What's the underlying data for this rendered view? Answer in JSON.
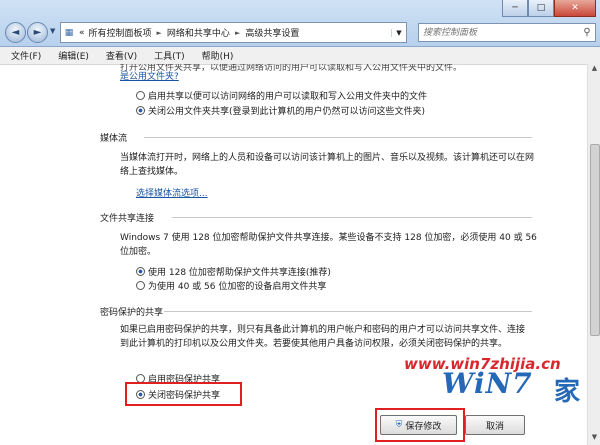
{
  "window": {
    "minimize_glyph": "─",
    "maximize_glyph": "□",
    "close_glyph": "✕"
  },
  "nav": {
    "back_glyph": "◄",
    "forward_glyph": "►",
    "address_icon": "control-panel-icon",
    "address_prefix": "«",
    "breadcrumbs": [
      "所有控制面板项",
      "网络和共享中心",
      "高级共享设置"
    ],
    "refresh_glyph": "↻",
    "search_placeholder": "搜索控制面板"
  },
  "menu": [
    "文件(F)",
    "编辑(E)",
    "查看(V)",
    "工具(T)",
    "帮助(H)"
  ],
  "sections": {
    "public_folder": {
      "truncated_top": "打开公用文件夹共享，以便通过网络访问的用户可以读取和写入公用文件夹中的文件。",
      "truncated_link": "是公用文件夹?",
      "option_on": "启用共享以便可以访问网络的用户可以读取和写入公用文件夹中的文件",
      "option_off": "关闭公用文件夹共享(登录到此计算机的用户仍然可以访问这些文件夹)"
    },
    "media": {
      "title": "媒体流",
      "desc": "当媒体流打开时，网络上的人员和设备可以访问该计算机上的图片、音乐以及视频。该计算机还可以在网络上查找媒体。",
      "link": "选择媒体流选项..."
    },
    "file_sharing": {
      "title": "文件共享连接",
      "desc": "Windows 7 使用 128 位加密帮助保护文件共享连接。某些设备不支持 128 位加密，必须使用 40 或 56 位加密。",
      "option_128": "使用 128 位加密帮助保护文件共享连接(推荐)",
      "option_40": "为使用 40 或 56 位加密的设备启用文件共享"
    },
    "password": {
      "title": "密码保护的共享",
      "desc": "如果已启用密码保护的共享，则只有具备此计算机的用户帐户和密码的用户才可以访问共享文件、连接到此计算机的打印机以及公用文件夹。若要使其他用户具备访问权限，必须关闭密码保护的共享。",
      "option_on": "启用密码保护共享",
      "option_off": "关闭密码保护共享"
    }
  },
  "buttons": {
    "save": "保存修改",
    "cancel": "取消"
  },
  "watermark": {
    "url": "www.win7zhijia.cn",
    "brand": "WiN7",
    "suffix": "家"
  },
  "colors": {
    "link": "#1a55a5",
    "highlight": "#e02020",
    "brand": "#2668b8"
  }
}
